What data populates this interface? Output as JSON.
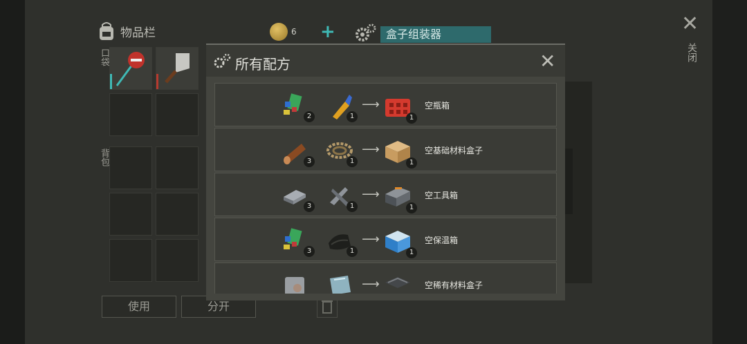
{
  "inventory": {
    "title": "物品栏",
    "coins": "6",
    "pocket_label": "口袋",
    "backpack_label": "背包",
    "use_button": "使用",
    "split_button": "分开"
  },
  "assembler": {
    "label": "盒子组装器"
  },
  "close": {
    "label": "关闭"
  },
  "modal": {
    "title": "所有配方",
    "recipes": [
      {
        "name": "空瓶箱",
        "ing1_icon": "fabric-scraps-icon",
        "ing1_qty": "2",
        "ing2_icon": "glue-tube-icon",
        "ing2_qty": "1",
        "out_icon": "red-crate-icon",
        "out_qty": "1"
      },
      {
        "name": "空基础材料盒子",
        "ing1_icon": "log-icon",
        "ing1_qty": "3",
        "ing2_icon": "rope-icon",
        "ing2_qty": "1",
        "out_icon": "wooden-box-icon",
        "out_qty": "1"
      },
      {
        "name": "空工具箱",
        "ing1_icon": "metal-bar-icon",
        "ing1_qty": "3",
        "ing2_icon": "metal-parts-icon",
        "ing2_qty": "1",
        "out_icon": "toolbox-icon",
        "out_qty": "1"
      },
      {
        "name": "空保温箱",
        "ing1_icon": "fabric-scraps-icon",
        "ing1_qty": "3",
        "ing2_icon": "black-cloth-icon",
        "ing2_qty": "1",
        "out_icon": "cooler-box-icon",
        "out_qty": "1"
      },
      {
        "name": "空稀有材料盒子",
        "ing1_icon": "metal-plate-icon",
        "ing1_qty": "",
        "ing2_icon": "glass-plate-icon",
        "ing2_qty": "",
        "out_icon": "dark-crate-icon",
        "out_qty": ""
      }
    ]
  }
}
